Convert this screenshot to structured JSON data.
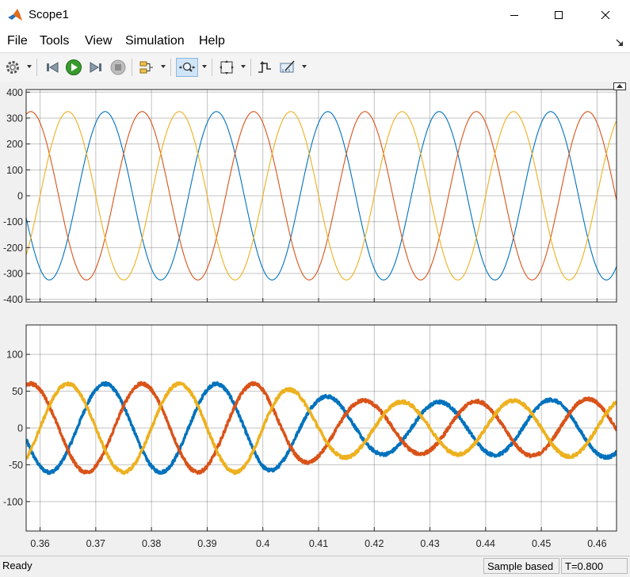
{
  "window": {
    "title": "Scope1",
    "icon": "matlab-icon",
    "controls": [
      "minimize-icon",
      "maximize-icon",
      "close-icon"
    ]
  },
  "menu": {
    "items": [
      "File",
      "Tools",
      "View",
      "Simulation",
      "Help"
    ],
    "undock_icon": "undock-arrow-icon"
  },
  "toolbar": {
    "buttons": [
      "settings-icon",
      "step-back-icon",
      "run-icon",
      "step-forward-icon",
      "stop-icon",
      "signal-select-icon",
      "zoom-icon",
      "scale-axes-icon",
      "triggers-icon",
      "measurements-icon"
    ],
    "active": "zoom-icon"
  },
  "status": {
    "left": "Ready",
    "mode": "Sample based",
    "time": "T=0.800"
  },
  "colors": {
    "background": "#f0f0f0",
    "plot_background": "#ffffff",
    "grid": "#262626",
    "series_blue": "#0072bd",
    "series_orange": "#d95319",
    "series_yellow": "#edb120"
  },
  "chart_data": [
    {
      "type": "line",
      "title": "",
      "xlabel": "",
      "ylabel": "",
      "xlim": [
        0.3575,
        0.4635
      ],
      "ylim": [
        -410,
        410
      ],
      "grid": true,
      "legend": "none",
      "yticks": [
        400,
        300,
        200,
        100,
        0,
        -100,
        -200,
        -300,
        -400
      ],
      "ytick_labels": [
        "400",
        "300",
        "200",
        "100",
        "0",
        "-100",
        "-200",
        "-300",
        "-400"
      ],
      "xticks": [
        0.36,
        0.37,
        0.38,
        0.39,
        0.4,
        0.41,
        0.42,
        0.43,
        0.44,
        0.45,
        0.46
      ],
      "show_xtick_labels": false,
      "series": [
        {
          "color": "#0072bd",
          "waveform": "sine",
          "amplitude": 325,
          "frequency_hz": 50,
          "phase_deg": -120,
          "noise": 0,
          "linewidth": 1.1
        },
        {
          "color": "#d95319",
          "waveform": "sine",
          "amplitude": 325,
          "frequency_hz": 50,
          "phase_deg": 120,
          "noise": 0,
          "linewidth": 1.1
        },
        {
          "color": "#edb120",
          "waveform": "sine",
          "amplitude": 325,
          "frequency_hz": 50,
          "phase_deg": 0,
          "noise": 0,
          "linewidth": 1.1
        }
      ]
    },
    {
      "type": "line",
      "title": "",
      "xlabel": "",
      "ylabel": "",
      "xlim": [
        0.3575,
        0.4635
      ],
      "ylim": [
        -140,
        140
      ],
      "grid": true,
      "legend": "none",
      "yticks": [
        100,
        50,
        0,
        -50,
        -100
      ],
      "ytick_labels": [
        "100",
        "50",
        "0",
        "-50",
        "-100"
      ],
      "xticks": [
        0.36,
        0.37,
        0.38,
        0.39,
        0.4,
        0.41,
        0.42,
        0.43,
        0.44,
        0.45,
        0.46
      ],
      "xtick_labels": [
        "0.36",
        "0.37",
        "0.38",
        "0.39",
        "0.4",
        "0.41",
        "0.42",
        "0.43",
        "0.44",
        "0.45",
        "0.46"
      ],
      "show_xtick_labels": true,
      "amplitude_profile": {
        "t": [
          0.3575,
          0.4,
          0.41,
          0.42,
          0.43,
          0.4635
        ],
        "amplitude": [
          60,
          60,
          44,
          36,
          35,
          40
        ]
      },
      "series": [
        {
          "color": "#0072bd",
          "waveform": "sine",
          "frequency_hz": 50,
          "phase_deg": -120,
          "noise": 2.2,
          "linewidth": 3.2
        },
        {
          "color": "#d95319",
          "waveform": "sine",
          "frequency_hz": 50,
          "phase_deg": 120,
          "noise": 2.2,
          "linewidth": 3.2
        },
        {
          "color": "#edb120",
          "waveform": "sine",
          "frequency_hz": 50,
          "phase_deg": 0,
          "noise": 2.2,
          "linewidth": 3.2
        }
      ]
    }
  ]
}
